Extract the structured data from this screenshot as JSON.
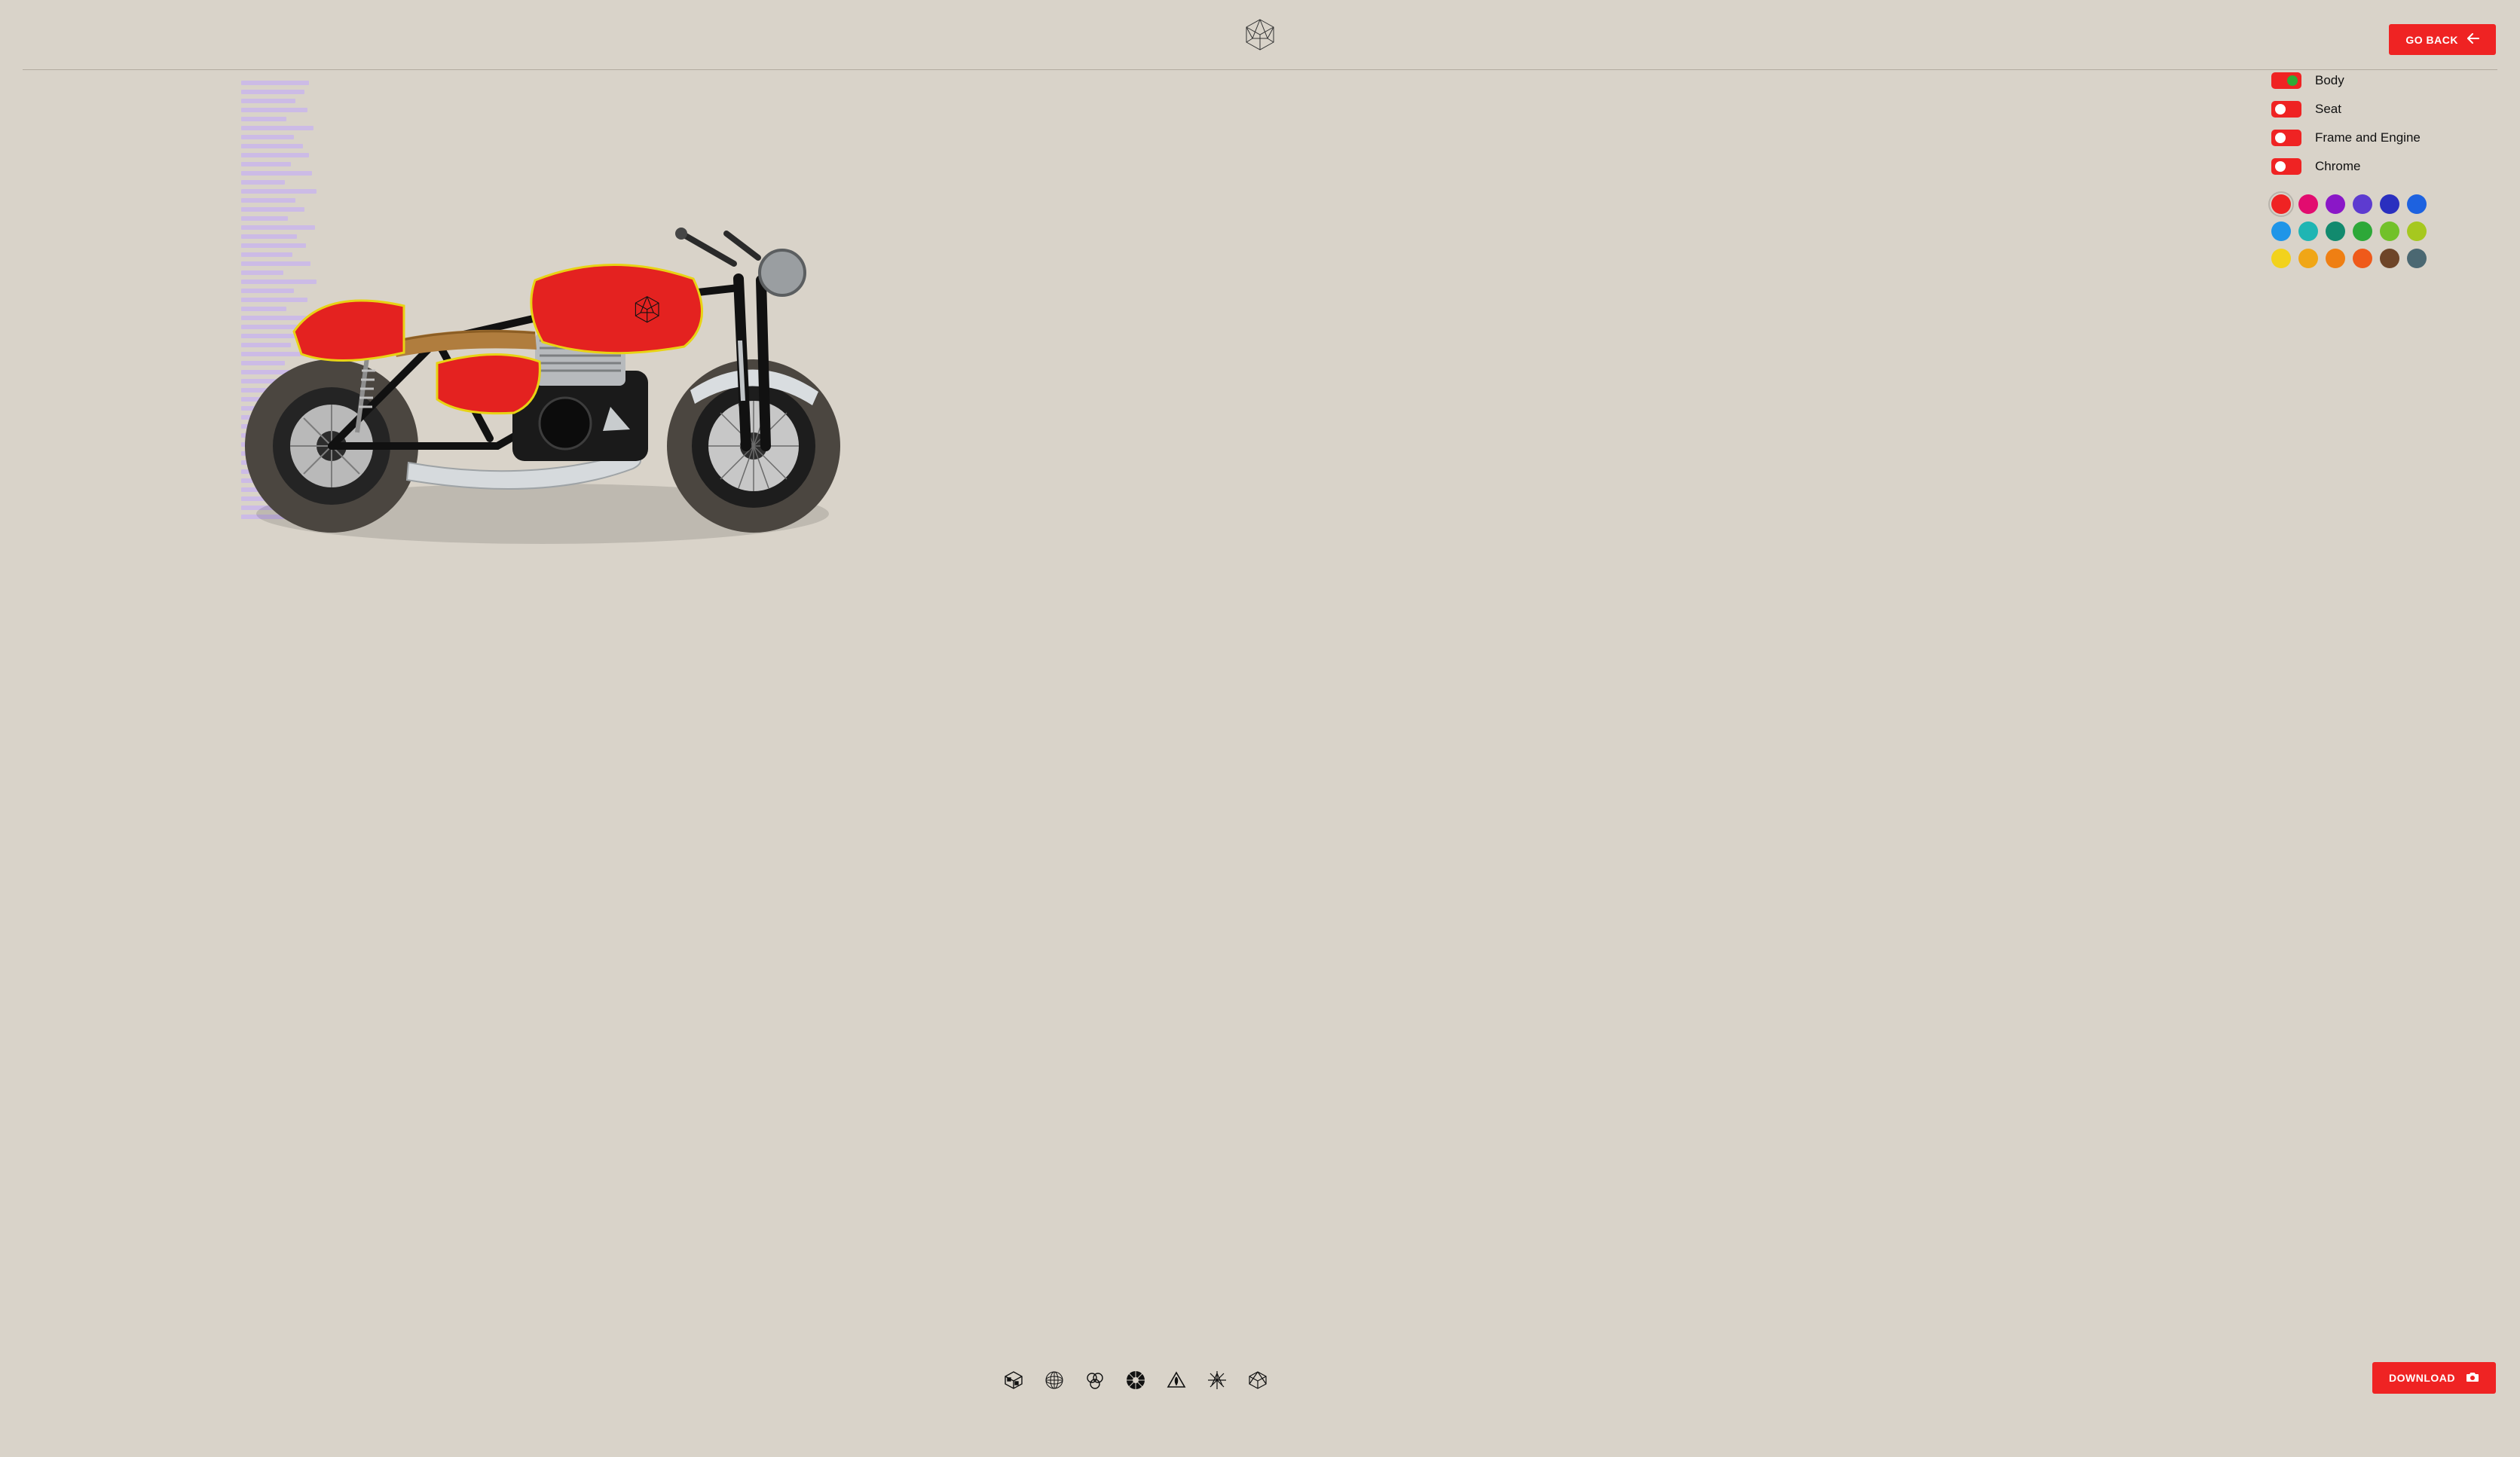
{
  "header": {
    "go_back_label": "GO BACK"
  },
  "panel": {
    "toggles": [
      {
        "label": "Body",
        "knob_side": "right",
        "knob_green": true
      },
      {
        "label": "Seat",
        "knob_side": "left",
        "knob_green": false
      },
      {
        "label": "Frame and Engine",
        "knob_side": "left",
        "knob_green": false
      },
      {
        "label": "Chrome",
        "knob_side": "left",
        "knob_green": false
      }
    ],
    "colors": [
      {
        "hex": "#ef2323",
        "selected": true
      },
      {
        "hex": "#e20c6f"
      },
      {
        "hex": "#8a17c7"
      },
      {
        "hex": "#5d3bd0"
      },
      {
        "hex": "#2a2fbf"
      },
      {
        "hex": "#1d62e0"
      },
      {
        "hex": "#1f95e8"
      },
      {
        "hex": "#1fb5b3"
      },
      {
        "hex": "#128a6e"
      },
      {
        "hex": "#2da838"
      },
      {
        "hex": "#72c12a"
      },
      {
        "hex": "#a6c81f"
      },
      {
        "hex": "#f2d21c"
      },
      {
        "hex": "#f0a616"
      },
      {
        "hex": "#ef7f13"
      },
      {
        "hex": "#ef5a1a"
      },
      {
        "hex": "#6e4528"
      },
      {
        "hex": "#4b6872"
      }
    ]
  },
  "footer": {
    "download_label": "DOWNLOAD"
  }
}
